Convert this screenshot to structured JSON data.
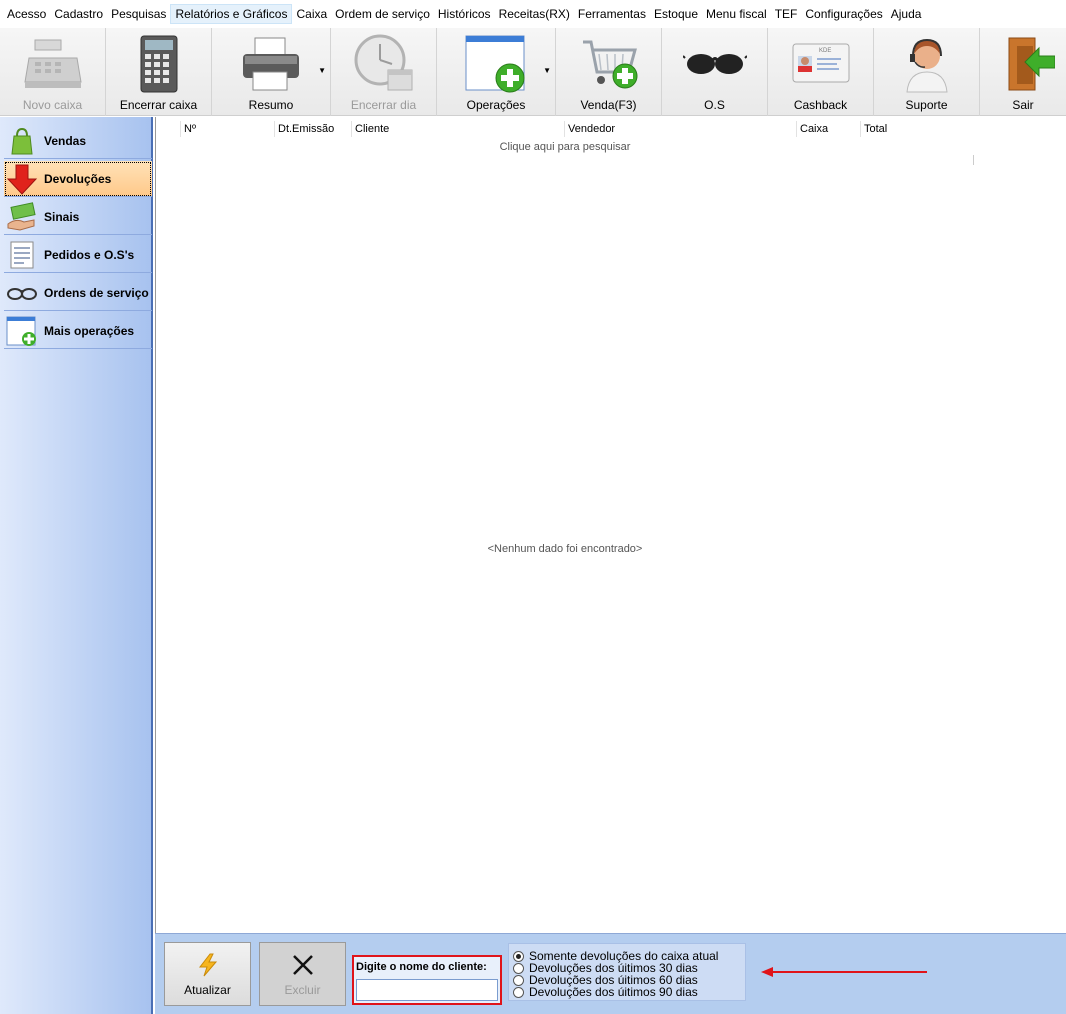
{
  "menu": [
    "Acesso",
    "Cadastro",
    "Pesquisas",
    "Relatórios e Gráficos",
    "Caixa",
    "Ordem de serviço",
    "Históricos",
    "Receitas(RX)",
    "Ferramentas",
    "Estoque",
    "Menu fiscal",
    "TEF",
    "Configurações",
    "Ajuda"
  ],
  "toolbar": {
    "novo_caixa": "Novo caixa",
    "encerrar_caixa": "Encerrar caixa",
    "resumo": "Resumo",
    "encerrar_dia": "Encerrar dia",
    "operacoes": "Operações",
    "venda": "Venda(F3)",
    "os": "O.S",
    "cashback": "Cashback",
    "suporte": "Suporte",
    "sair": "Sair",
    "card_text": "KDE"
  },
  "sidebar": [
    "Vendas",
    "Devoluções",
    "Sinais",
    "Pedidos e O.S's",
    "Ordens de serviço",
    "Mais operações"
  ],
  "grid": {
    "columns": [
      "Nº",
      "Dt.Emissão",
      "Cliente",
      "Vendedor",
      "Caixa",
      "Total"
    ],
    "search_hint": "Clique aqui para pesquisar",
    "empty_text": "<Nenhum dado foi encontrado>"
  },
  "bottom": {
    "atualizar": "Atualizar",
    "excluir": "Excluir",
    "client_label": "Digite o nome do cliente:",
    "client_value": "",
    "radios": [
      "Somente devoluções do caixa atual",
      "Devoluções dos úitimos 30 dias",
      "Devoluções dos úitimos 60 dias",
      "Devoluções dos úitimos 90 dias"
    ]
  },
  "colors": {
    "highlight": "#e0141a",
    "sidebar_selected": "#ffc98a",
    "panel": "#b4cdef"
  }
}
